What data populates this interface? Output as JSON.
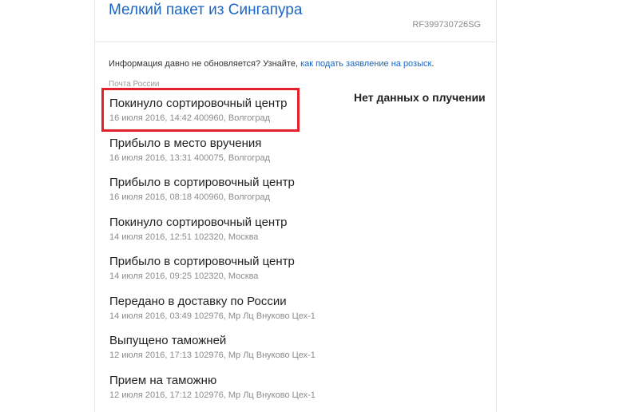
{
  "header": {
    "title": "Мелкий пакет из Сингапура",
    "tracking_number": "RF399730726SG"
  },
  "info": {
    "text": "Информация давно не обновляется? Узнайте, ",
    "link_text": "как подать заявление на розыск",
    "suffix": "."
  },
  "carrier_label": "Почта России",
  "annotation": {
    "no_delivery_data": "Нет данных о плучении",
    "highlight_color": "#e3202b"
  },
  "events": [
    {
      "title": "Покинуло сортировочный центр",
      "meta": "16 июля 2016, 14:42 400960, Волгоград"
    },
    {
      "title": "Прибыло в место вручения",
      "meta": "16 июля 2016, 13:31 400075, Волгоград"
    },
    {
      "title": "Прибыло в сортировочный центр",
      "meta": "16 июля 2016, 08:18 400960, Волгоград"
    },
    {
      "title": "Покинуло сортировочный центр",
      "meta": "14 июля 2016, 12:51 102320, Москва"
    },
    {
      "title": "Прибыло в сортировочный центр",
      "meta": "14 июля 2016, 09:25 102320, Москва"
    },
    {
      "title": "Передано в доставку по России",
      "meta": "14 июля 2016, 03:49 102976, Мр Лц Внуково Цех-1"
    },
    {
      "title": "Выпущено таможней",
      "meta": "12 июля 2016, 17:13 102976, Мр Лц Внуково Цех-1"
    },
    {
      "title": "Прием на таможню",
      "meta": "12 июля 2016, 17:12 102976, Мр Лц Внуково Цех-1"
    }
  ]
}
